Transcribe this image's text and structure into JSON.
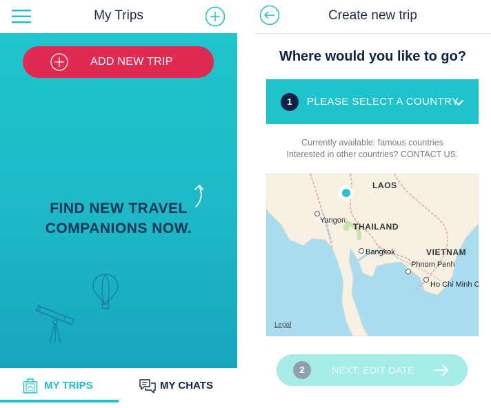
{
  "left": {
    "header": {
      "title": "My Trips"
    },
    "add_trip_label": "ADD NEW TRIP",
    "tagline": [
      "FIND NEW TRAVEL",
      "COMPANIONS NOW."
    ],
    "tabs": [
      {
        "label": "MY TRIPS",
        "icon": "suitcase-icon",
        "active": true
      },
      {
        "label": "MY CHATS",
        "icon": "chat-bubbles-icon",
        "active": false
      }
    ]
  },
  "right": {
    "header": {
      "title": "Create new trip"
    },
    "question": "Where would you like to go?",
    "step1": {
      "number": "1",
      "label": "PLEASE SELECT A COUNTRY"
    },
    "availability": [
      "Currently available: famous countries",
      "Interested in other countries? CONTACT US."
    ],
    "map": {
      "countries": [
        "LAOS",
        "THAILAND",
        "VIETNAM"
      ],
      "cities": [
        "Yangon",
        "Bangkok",
        "Phnom Penh",
        "Ho Chi Minh City"
      ],
      "legal": "Legal"
    },
    "step2": {
      "number": "2",
      "label": "NEXT: EDIT DATE"
    }
  },
  "colors": {
    "accent": "#1fc3cb",
    "primary_button": "#e12a52",
    "dark_text": "#0d2244",
    "disabled_button": "#a6ece9"
  }
}
